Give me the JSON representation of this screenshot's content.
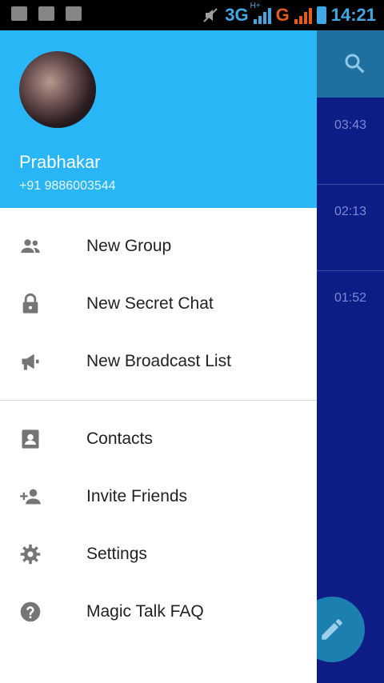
{
  "status_bar": {
    "network": "3G",
    "network_badge": "H+",
    "second_network": "G",
    "time": "14:21"
  },
  "drawer": {
    "user": {
      "name": "Prabhakar",
      "phone": "+91 9886003544"
    },
    "menu": [
      {
        "label": "New Group",
        "icon": "group-icon"
      },
      {
        "label": "New Secret Chat",
        "icon": "lock-icon"
      },
      {
        "label": "New Broadcast List",
        "icon": "megaphone-icon"
      },
      {
        "label": "Contacts",
        "icon": "contacts-icon"
      },
      {
        "label": "Invite Friends",
        "icon": "add-person-icon"
      },
      {
        "label": "Settings",
        "icon": "gear-icon"
      },
      {
        "label": "Magic Talk FAQ",
        "icon": "help-icon"
      }
    ]
  },
  "background_list": {
    "times": [
      "03:43",
      "02:13",
      "01:52"
    ]
  },
  "colors": {
    "header": "#29b6f6",
    "icon": "#757575",
    "background_app": "#0e1c86"
  }
}
